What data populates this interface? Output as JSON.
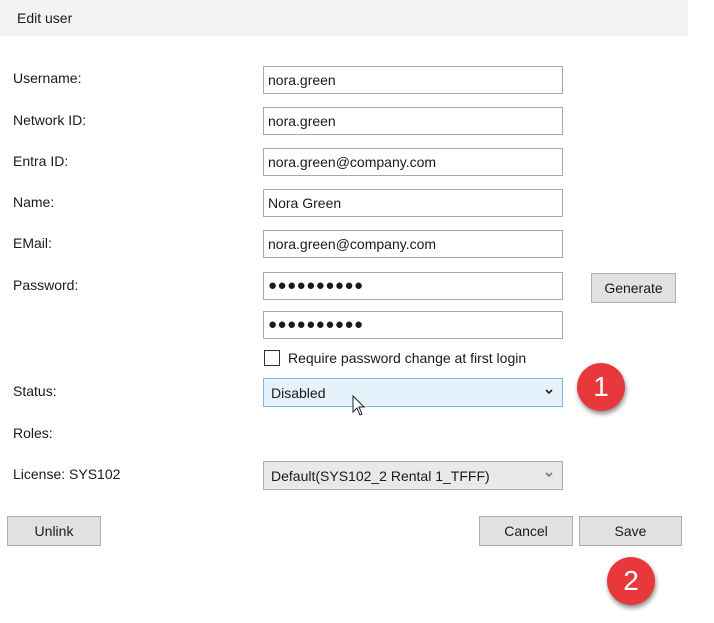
{
  "dialog": {
    "title": "Edit user"
  },
  "fields": {
    "username": {
      "label": "Username:",
      "value": "nora.green"
    },
    "network_id": {
      "label": "Network ID:",
      "value": "nora.green"
    },
    "entra_id": {
      "label": "Entra ID:",
      "value": "nora.green@company.com"
    },
    "name": {
      "label": "Name:",
      "value": "Nora Green"
    },
    "email": {
      "label": "EMail:",
      "value": "nora.green@company.com"
    },
    "password": {
      "label": "Password:",
      "value": "●●●●●●●●●●",
      "confirm_value": "●●●●●●●●●●"
    },
    "require_change": {
      "label": "Require password change at first login",
      "checked": false
    },
    "status": {
      "label": "Status:",
      "selected": "Disabled"
    },
    "roles": {
      "label": "Roles:"
    },
    "license": {
      "label": "License: SYS102",
      "selected": "Default(SYS102_2 Rental 1_TFFF)"
    }
  },
  "buttons": {
    "generate": "Generate",
    "unlink": "Unlink",
    "cancel": "Cancel",
    "save": "Save"
  },
  "annotations": {
    "step1": "1",
    "step2": "2",
    "color": "#e8383c"
  },
  "icons": {
    "dropdown": "chevron-down-icon",
    "cursor": "mouse-pointer-icon"
  }
}
